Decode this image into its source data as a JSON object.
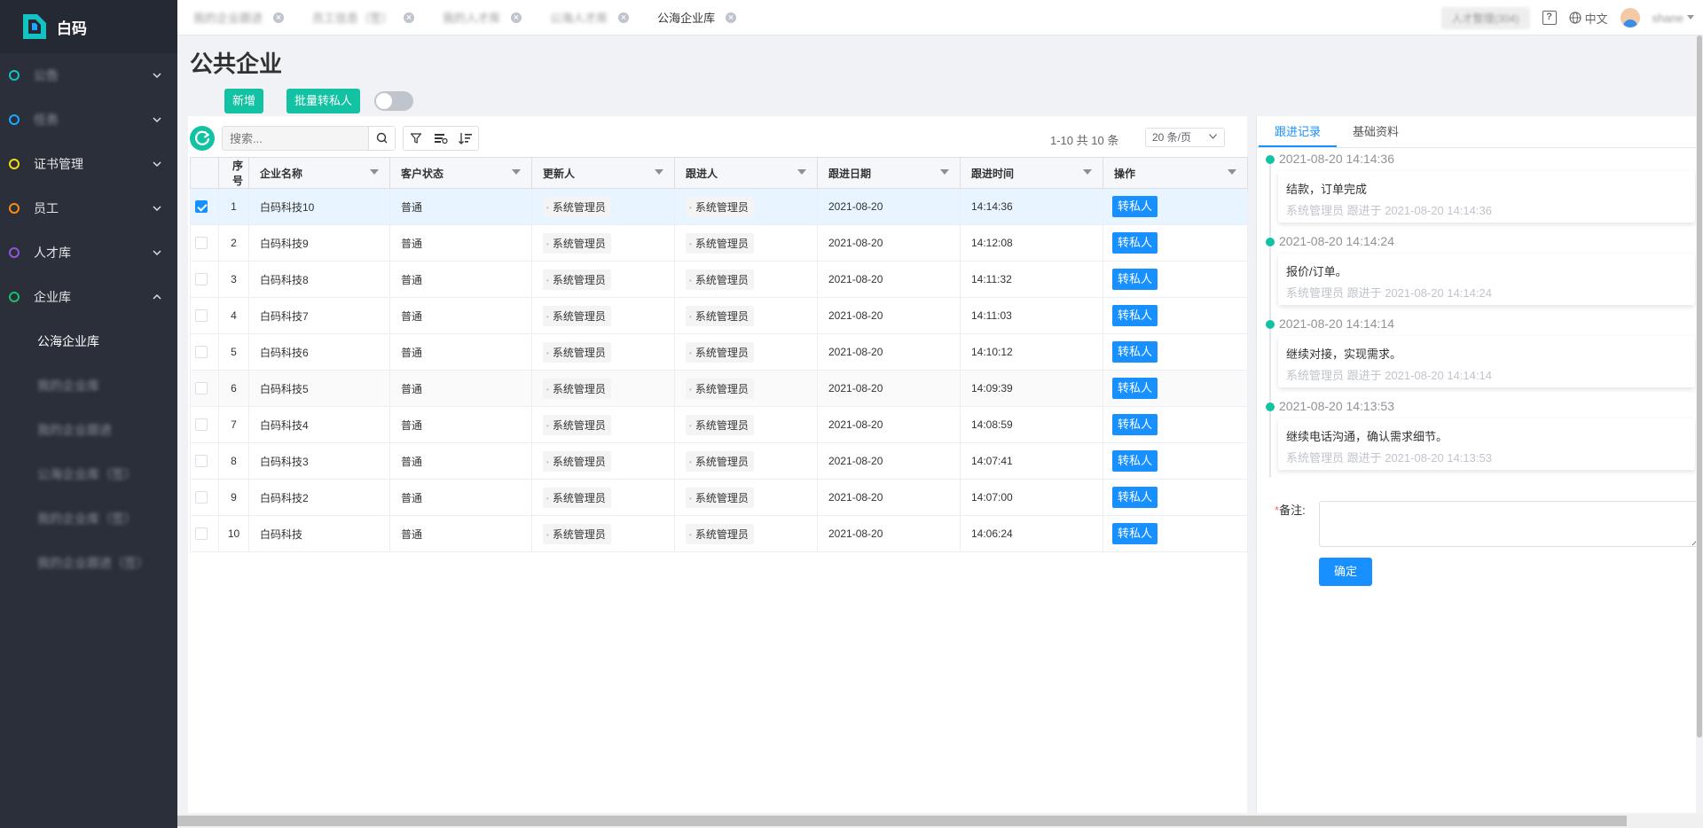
{
  "app": {
    "name": "白码"
  },
  "sidebar": {
    "items": [
      {
        "label": "公告",
        "color": "#13c2c2",
        "blurred": true
      },
      {
        "label": "任务",
        "color": "#1ea7ff",
        "blurred": true
      },
      {
        "label": "证书管理",
        "color": "#fadb14",
        "blurred": false
      },
      {
        "label": "员工",
        "color": "#fa8c16",
        "blurred": false
      },
      {
        "label": "人才库",
        "color": "#9254de",
        "blurred": false
      },
      {
        "label": "企业库",
        "color": "#13c26b",
        "blurred": false,
        "expanded": true
      }
    ],
    "sub_items": [
      {
        "label": "公海企业库",
        "active": true,
        "blurred": false
      },
      {
        "label": "我的企业库",
        "active": false,
        "blurred": true
      },
      {
        "label": "我的企业跟进",
        "active": false,
        "blurred": true
      },
      {
        "label": "公海企业库（签）",
        "active": false,
        "blurred": true
      },
      {
        "label": "我的企业库（签）",
        "active": false,
        "blurred": true
      },
      {
        "label": "我的企业跟进（签）",
        "active": false,
        "blurred": true
      }
    ]
  },
  "tabs": [
    {
      "label": "我的企业跟进",
      "active": false,
      "blurred": true
    },
    {
      "label": "员工信息（签）",
      "active": false,
      "blurred": true
    },
    {
      "label": "我的人才库",
      "active": false,
      "blurred": true
    },
    {
      "label": "公海人才库",
      "active": false,
      "blurred": true
    },
    {
      "label": "公海企业库",
      "active": true,
      "blurred": false
    }
  ],
  "topbar": {
    "pill": "人才整理(304)",
    "language": "中文",
    "user": "shane"
  },
  "page": {
    "title": "公共企业",
    "add_label": "新增",
    "batch_label": "批量转私人"
  },
  "toolbar": {
    "search_placeholder": "搜索...",
    "pager_text": "1-10 共 10 条",
    "page_size": "20 条/页"
  },
  "table": {
    "headers": [
      "序号",
      "企业名称",
      "客户状态",
      "更新人",
      "跟进人",
      "跟进日期",
      "跟进时间",
      "操作"
    ],
    "action_label": "转私人",
    "rows": [
      {
        "idx": "1",
        "name": "白码科技10",
        "status": "普通",
        "updater": "系统管理员",
        "follower": "系统管理员",
        "date": "2021-08-20",
        "time": "14:14:36",
        "checked": true
      },
      {
        "idx": "2",
        "name": "白码科技9",
        "status": "普通",
        "updater": "系统管理员",
        "follower": "系统管理员",
        "date": "2021-08-20",
        "time": "14:12:08",
        "checked": false
      },
      {
        "idx": "3",
        "name": "白码科技8",
        "status": "普通",
        "updater": "系统管理员",
        "follower": "系统管理员",
        "date": "2021-08-20",
        "time": "14:11:32",
        "checked": false
      },
      {
        "idx": "4",
        "name": "白码科技7",
        "status": "普通",
        "updater": "系统管理员",
        "follower": "系统管理员",
        "date": "2021-08-20",
        "time": "14:11:03",
        "checked": false
      },
      {
        "idx": "5",
        "name": "白码科技6",
        "status": "普通",
        "updater": "系统管理员",
        "follower": "系统管理员",
        "date": "2021-08-20",
        "time": "14:10:12",
        "checked": false
      },
      {
        "idx": "6",
        "name": "白码科技5",
        "status": "普通",
        "updater": "系统管理员",
        "follower": "系统管理员",
        "date": "2021-08-20",
        "time": "14:09:39",
        "checked": false
      },
      {
        "idx": "7",
        "name": "白码科技4",
        "status": "普通",
        "updater": "系统管理员",
        "follower": "系统管理员",
        "date": "2021-08-20",
        "time": "14:08:59",
        "checked": false
      },
      {
        "idx": "8",
        "name": "白码科技3",
        "status": "普通",
        "updater": "系统管理员",
        "follower": "系统管理员",
        "date": "2021-08-20",
        "time": "14:07:41",
        "checked": false
      },
      {
        "idx": "9",
        "name": "白码科技2",
        "status": "普通",
        "updater": "系统管理员",
        "follower": "系统管理员",
        "date": "2021-08-20",
        "time": "14:07:00",
        "checked": false
      },
      {
        "idx": "10",
        "name": "白码科技",
        "status": "普通",
        "updater": "系统管理员",
        "follower": "系统管理员",
        "date": "2021-08-20",
        "time": "14:06:24",
        "checked": false
      }
    ]
  },
  "right_panel": {
    "tabs": [
      {
        "label": "跟进记录",
        "active": true
      },
      {
        "label": "基础资料",
        "active": false
      }
    ],
    "timeline": [
      {
        "time": "2021-08-20 14:14:36",
        "content": "结款，订单完成",
        "meta": "系统管理员 跟进于 2021-08-20 14:14:36"
      },
      {
        "time": "2021-08-20 14:14:24",
        "content": "报价/订单。",
        "meta": "系统管理员 跟进于 2021-08-20 14:14:24"
      },
      {
        "time": "2021-08-20 14:14:14",
        "content": "继续对接，实现需求。",
        "meta": "系统管理员 跟进于 2021-08-20 14:14:14"
      },
      {
        "time": "2021-08-20 14:13:53",
        "content": "继续电话沟通，确认需求细节。",
        "meta": "系统管理员 跟进于 2021-08-20 14:13:53"
      }
    ],
    "remark_star": "*",
    "remark_label": "备注:",
    "confirm_label": "确定"
  },
  "colors": {
    "accent_green": "#13c2a3",
    "accent_blue": "#1890ff",
    "sidebar_bg": "#2b2f3a"
  }
}
